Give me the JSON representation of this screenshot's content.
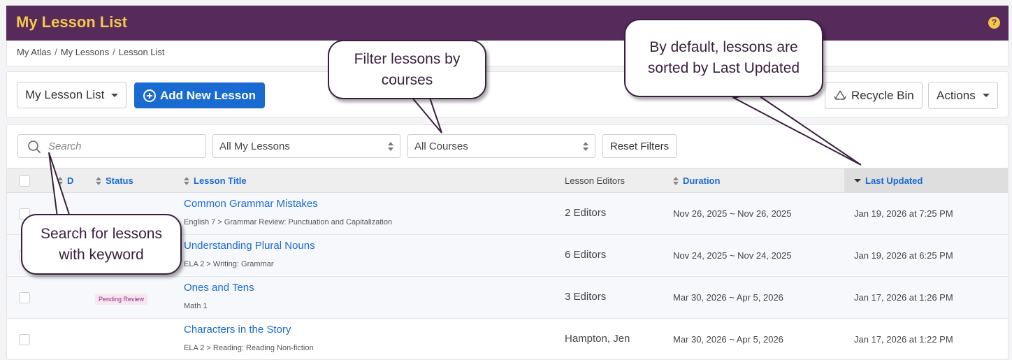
{
  "header": {
    "title": "My Lesson List",
    "help_icon": "?"
  },
  "breadcrumb": [
    "My Atlas",
    "My Lessons",
    "Lesson List"
  ],
  "breadcrumb_sep": "/",
  "toolbar": {
    "list_select": "My Lesson List",
    "add_label": "Add New Lesson",
    "recycle_label": "Recycle Bin",
    "actions_label": "Actions"
  },
  "filters": {
    "search_placeholder": "Search",
    "lessons_select": "All My Lessons",
    "courses_select": "All Courses",
    "reset_label": "Reset Filters"
  },
  "table": {
    "headers": {
      "d": "D",
      "status": "Status",
      "title": "Lesson Title",
      "editors": "Lesson Editors",
      "duration": "Duration",
      "updated": "Last Updated"
    },
    "rows": [
      {
        "title": "Common Grammar Mistakes",
        "path": "English 7 > Grammar Review: Punctuation and Capitalization",
        "editors": "2 Editors",
        "duration": "Nov 26, 2025 ~ Nov 26, 2025",
        "updated": "Jan 19, 2026 at 7:25 PM",
        "status": ""
      },
      {
        "title": "Understanding Plural Nouns",
        "path": "ELA 2 > Writing: Grammar",
        "editors": "6 Editors",
        "duration": "Nov 24, 2025 ~ Nov 24, 2025",
        "updated": "Jan 19, 2026 at 6:25 PM",
        "status": ""
      },
      {
        "title": "Ones and Tens",
        "path": "Math 1",
        "editors": "3 Editors",
        "duration": "Mar 30, 2026 ~ Apr 5, 2026",
        "updated": "Jan 17, 2026 at 1:26 PM",
        "status": "Pending Review"
      },
      {
        "title": "Characters in the Story",
        "path": "ELA 2 > Reading: Reading Non-fiction",
        "editors": "Hampton, Jen",
        "duration": "Mar 30, 2026 ~ Apr 5, 2026",
        "updated": "Jan 17, 2026 at 1:22 PM",
        "status": ""
      }
    ]
  },
  "callouts": {
    "filter": "Filter lessons by courses",
    "sorted": "By default, lessons are sorted by Last Updated",
    "search": "Search for lessons with keyword"
  },
  "colors": {
    "header_bg": "#562a5b",
    "header_title": "#f4c84a",
    "link": "#1a6bd1",
    "primary": "#1a6bd1"
  }
}
